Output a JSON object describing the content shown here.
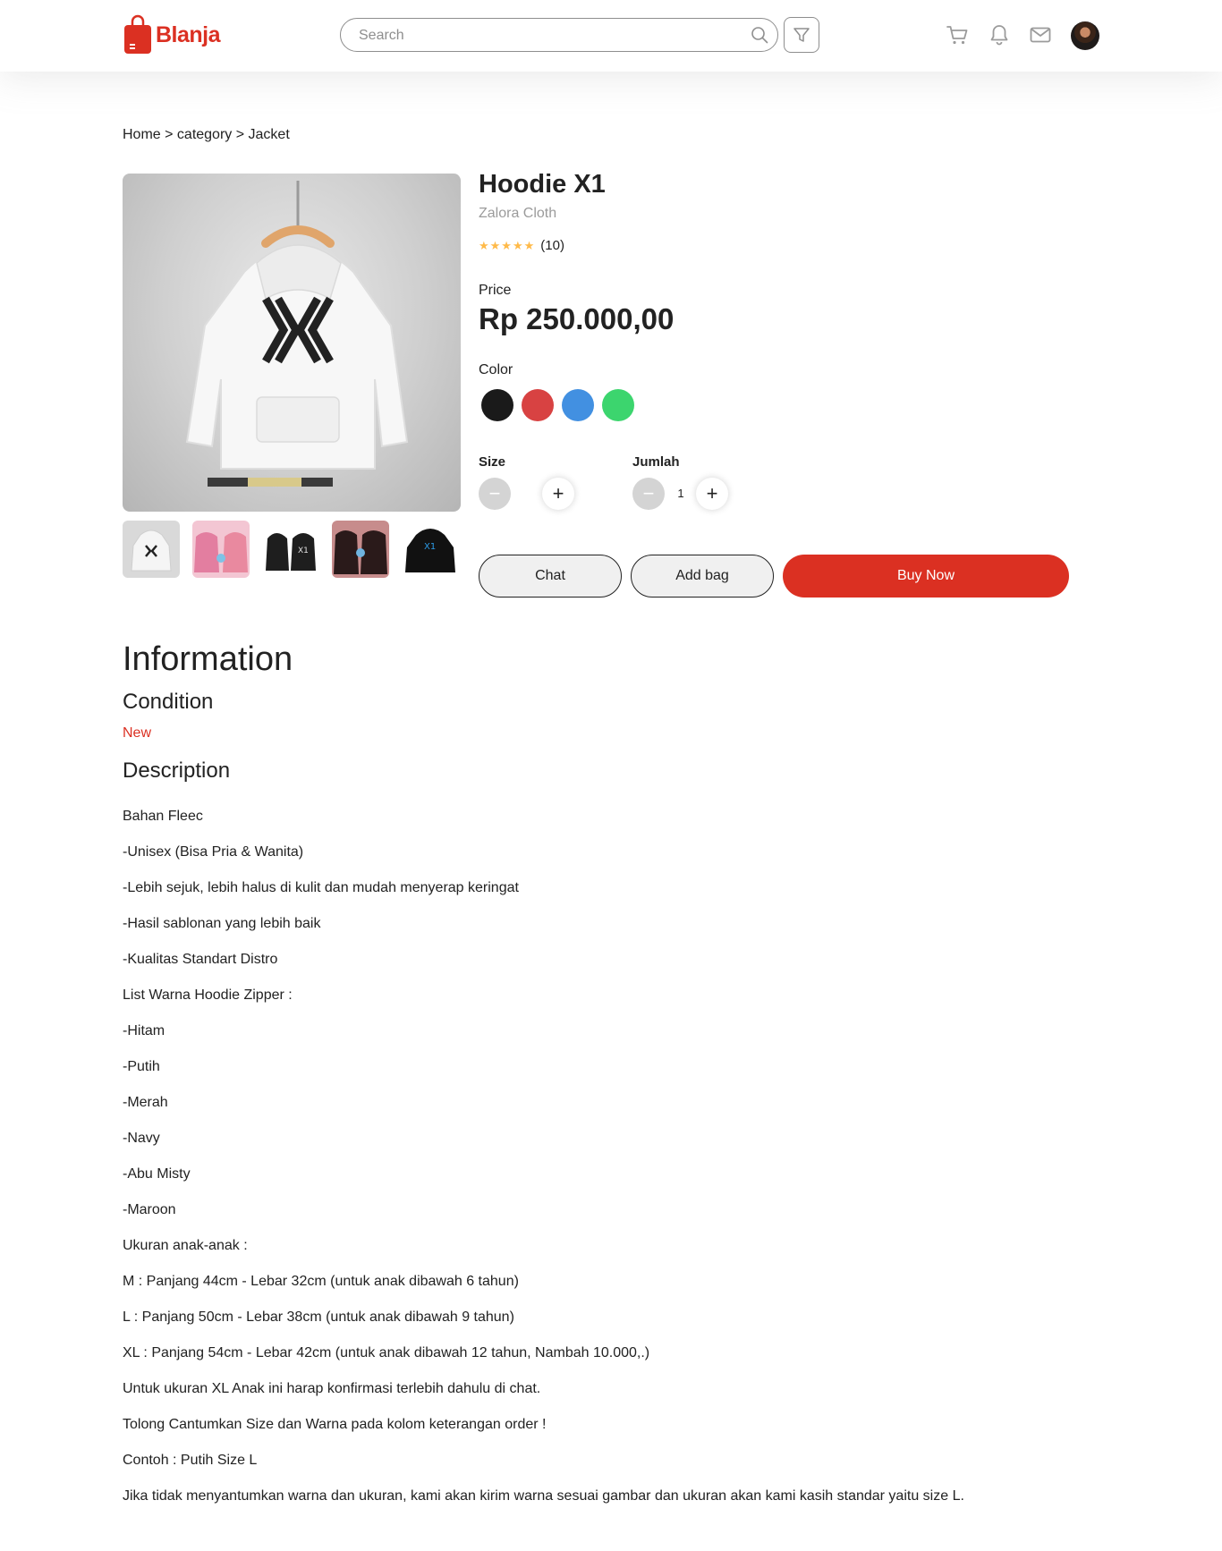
{
  "header": {
    "brand": "Blanja",
    "search_placeholder": "Search",
    "icons": [
      "cart-icon",
      "bell-icon",
      "mail-icon"
    ]
  },
  "breadcrumb": "Home > category > Jacket",
  "product": {
    "name": "Hoodie X1",
    "store": "Zalora Cloth",
    "rating_stars": 5,
    "review_count": "(10)",
    "price_label": "Price",
    "price": "Rp 250.000,00",
    "color_label": "Color",
    "colors": [
      "#1a1a1a",
      "#d84242",
      "#4290e1",
      "#3cd56e"
    ],
    "size_label": "Size",
    "quantity_label": "Jumlah",
    "quantity_value": "1",
    "thumbnail_count": 5
  },
  "actions": {
    "chat": "Chat",
    "add_bag": "Add bag",
    "buy_now": "Buy Now"
  },
  "info": {
    "title": "Information",
    "condition_title": "Condition",
    "condition_value": "New",
    "description_title": "Description",
    "description_lines": [
      "Bahan Fleec",
      "-Unisex (Bisa Pria & Wanita)",
      "-Lebih sejuk, lebih halus di kulit dan mudah menyerap keringat",
      "-Hasil sablonan yang lebih baik",
      "-Kualitas Standart Distro",
      "List Warna Hoodie Zipper :",
      "-Hitam",
      "-Putih",
      "-Merah",
      "-Navy",
      "-Abu Misty",
      "-Maroon",
      "Ukuran anak-anak :",
      "M : Panjang 44cm - Lebar 32cm (untuk anak dibawah 6 tahun)",
      "L : Panjang 50cm - Lebar 38cm (untuk anak dibawah 9 tahun)",
      "XL : Panjang 54cm - Lebar 42cm (untuk anak dibawah 12 tahun, Nambah 10.000,.)",
      "Untuk ukuran XL Anak ini harap konfirmasi terlebih dahulu di chat.",
      "Tolong Cantumkan Size dan Warna pada kolom keterangan order !",
      "Contoh : Putih Size L",
      "Jika tidak menyantumkan warna dan ukuran, kami akan kirim warna sesuai gambar dan ukuran akan kami kasih standar yaitu size L."
    ]
  },
  "theme": {
    "primary": "#db3022",
    "star": "#ffba49",
    "muted": "#9b9b9b"
  }
}
